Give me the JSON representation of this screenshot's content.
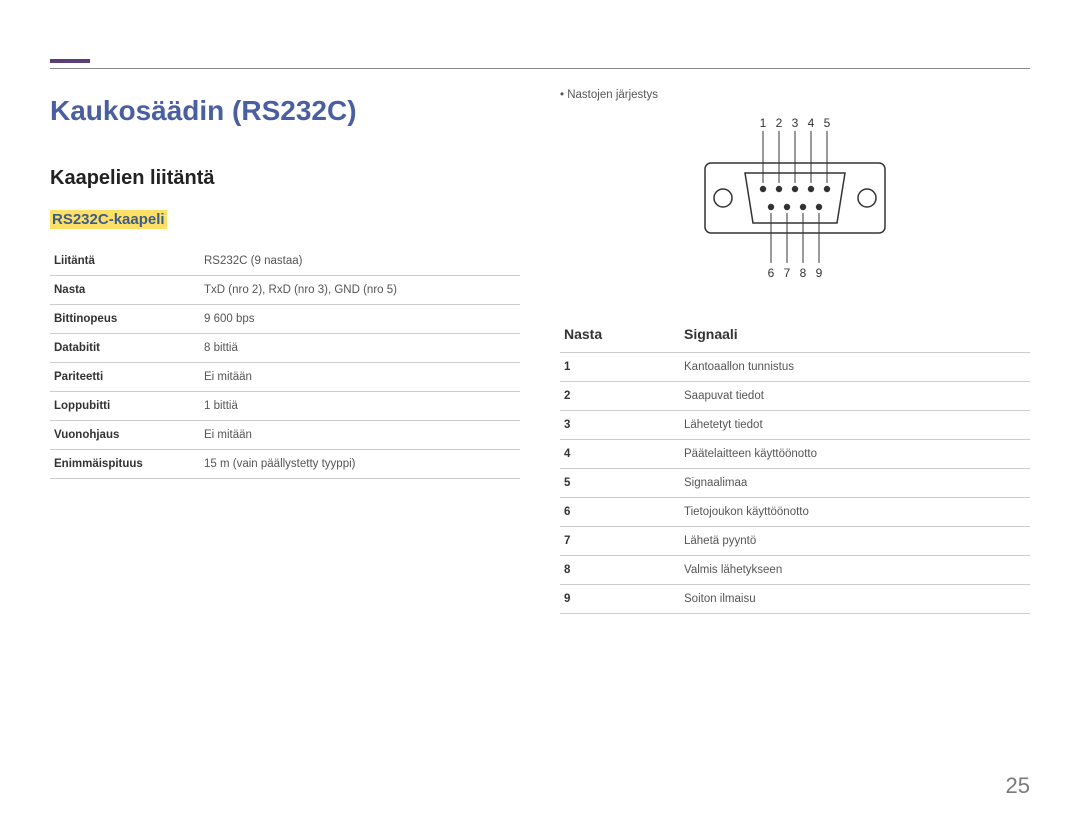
{
  "page": {
    "number": "25",
    "title": "Kaukosäädin (RS232C)",
    "section": "Kaapelien liitäntä",
    "subsection": "RS232C-kaapeli"
  },
  "spec": {
    "rows": [
      {
        "label": "Liitäntä",
        "value": "RS232C (9 nastaa)"
      },
      {
        "label": "Nasta",
        "value": "TxD (nro 2), RxD (nro 3), GND (nro 5)"
      },
      {
        "label": "Bittinopeus",
        "value": "9 600 bps"
      },
      {
        "label": "Databitit",
        "value": "8 bittiä"
      },
      {
        "label": "Pariteetti",
        "value": "Ei mitään"
      },
      {
        "label": "Loppubitti",
        "value": "1 bittiä"
      },
      {
        "label": "Vuonohjaus",
        "value": "Ei mitään"
      },
      {
        "label": "Enimmäispituus",
        "value": "15 m (vain päällystetty tyyppi)"
      }
    ]
  },
  "connector": {
    "note": "Nastojen järjestys",
    "top_labels": [
      "1",
      "2",
      "3",
      "4",
      "5"
    ],
    "bottom_labels": [
      "6",
      "7",
      "8",
      "9"
    ]
  },
  "signals": {
    "header_pin": "Nasta",
    "header_signal": "Signaali",
    "rows": [
      {
        "pin": "1",
        "name": "Kantoaallon tunnistus"
      },
      {
        "pin": "2",
        "name": "Saapuvat tiedot"
      },
      {
        "pin": "3",
        "name": "Lähetetyt tiedot"
      },
      {
        "pin": "4",
        "name": "Päätelaitteen käyttöönotto"
      },
      {
        "pin": "5",
        "name": "Signaalimaa"
      },
      {
        "pin": "6",
        "name": "Tietojoukon käyttöönotto"
      },
      {
        "pin": "7",
        "name": "Lähetä pyyntö"
      },
      {
        "pin": "8",
        "name": "Valmis lähetykseen"
      },
      {
        "pin": "9",
        "name": "Soiton ilmaisu"
      }
    ]
  }
}
